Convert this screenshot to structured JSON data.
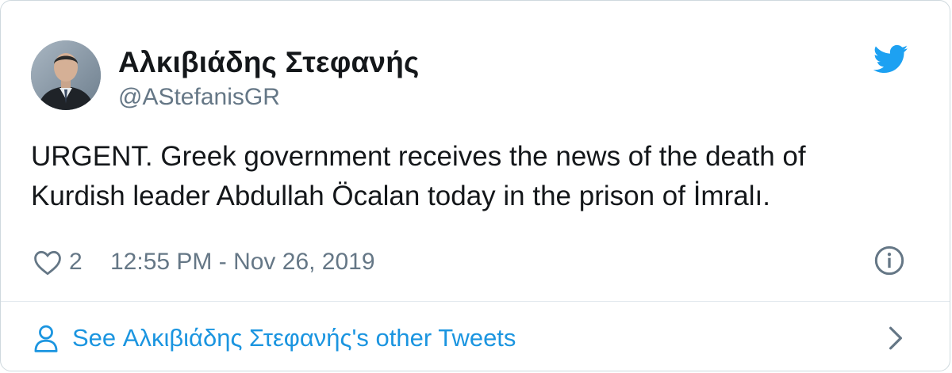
{
  "author": {
    "display_name": "Αλκιβιάδης Στεφανής",
    "handle": "@AStefanisGR"
  },
  "tweet": {
    "text": "URGENT. Greek government receives the news of the death of\nKurdish leader Abdullah Öcalan today in the prison of İmralı.",
    "likes": "2",
    "timestamp": "12:55 PM - Nov 26, 2019"
  },
  "footer": {
    "link_text": "See Αλκιβιάδης Στεφανής's other Tweets"
  },
  "icons": {
    "brand": "twitter-bird-icon",
    "like": "heart-icon",
    "info": "info-icon",
    "profile": "person-icon",
    "chevron": "chevron-right-icon"
  },
  "colors": {
    "brand_blue": "#1da1f2",
    "link_blue": "#1b95e0",
    "text_dark": "#14171a",
    "text_gray": "#657786",
    "border": "#cfd9de"
  }
}
